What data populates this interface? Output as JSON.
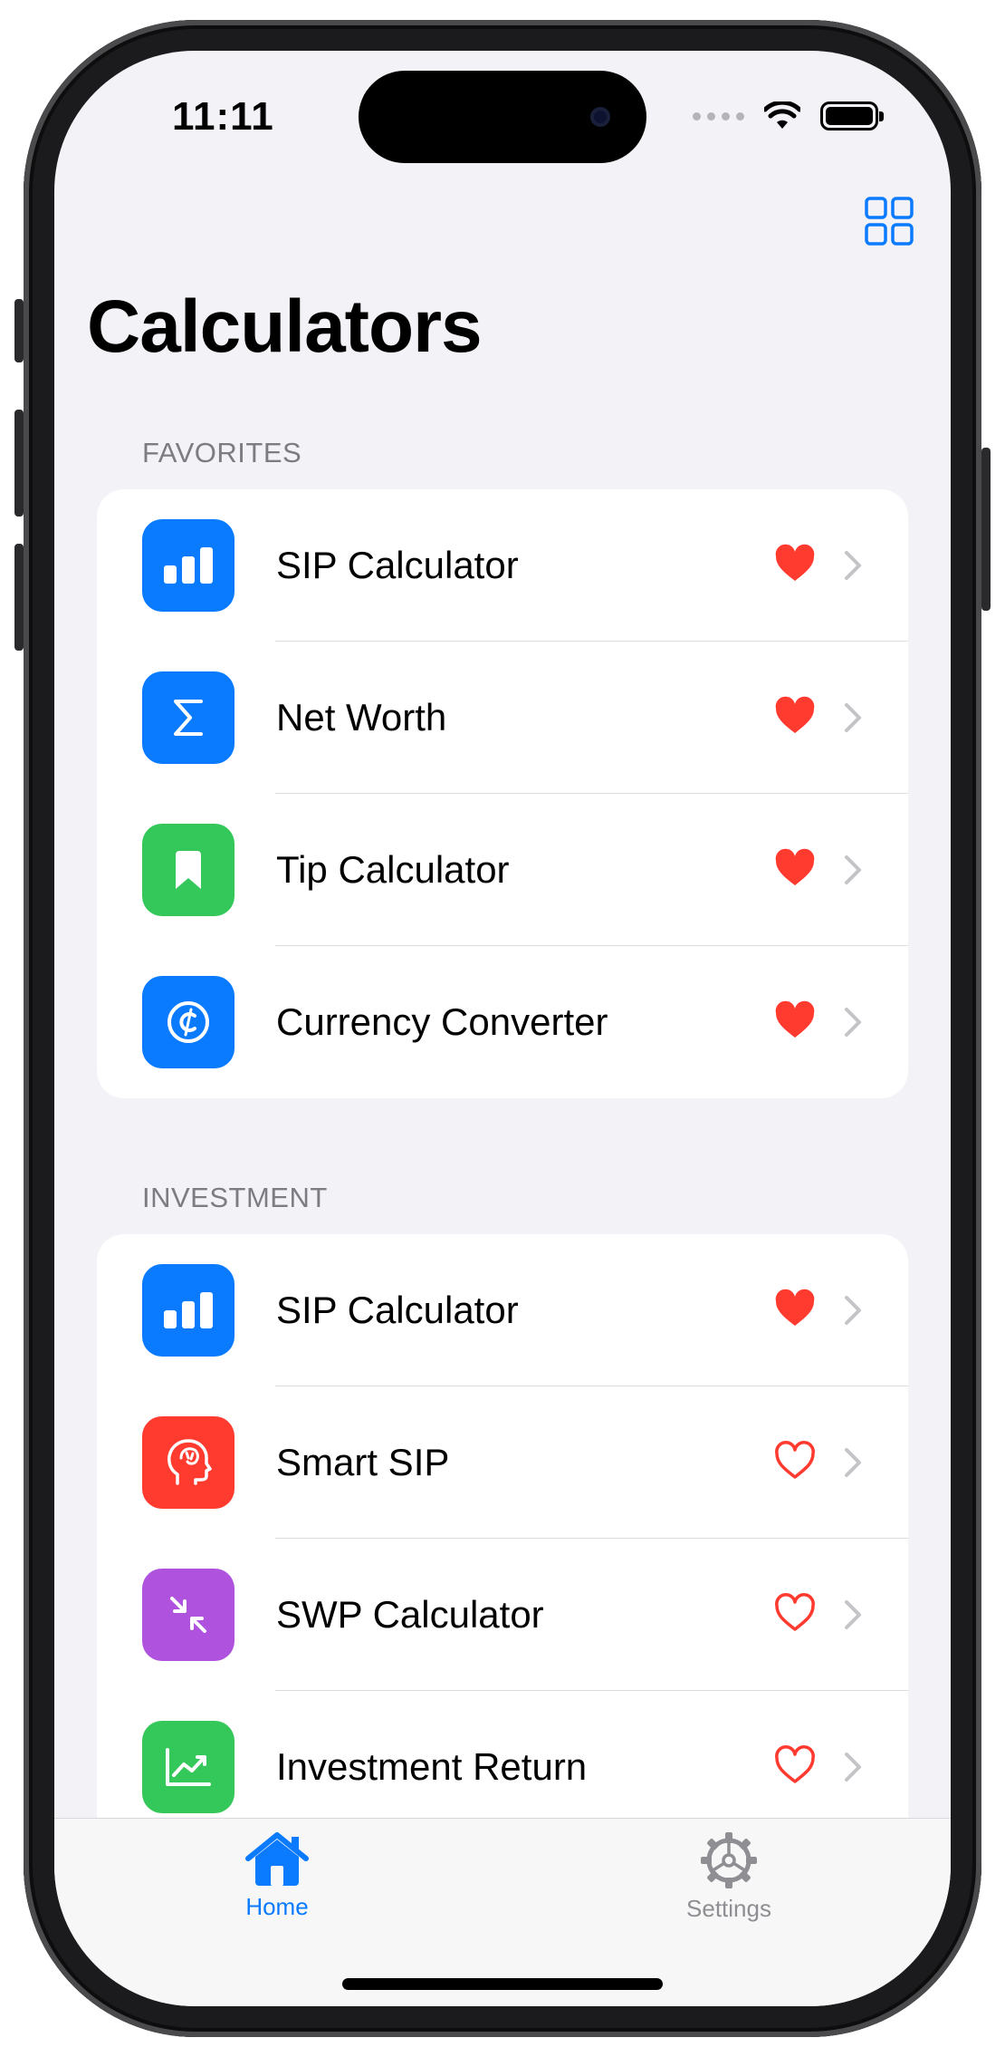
{
  "status_bar": {
    "time": "11:11"
  },
  "header": {
    "title": "Calculators",
    "grid_icon": "grid-icon"
  },
  "colors": {
    "accent": "#0a7aff",
    "heart": "#ff3b30",
    "green": "#34c759",
    "purple": "#af52de",
    "red": "#ff3b30"
  },
  "sections": [
    {
      "label": "FAVORITES",
      "items": [
        {
          "label": "SIP Calculator",
          "icon": "bar-chart-icon",
          "favorite": true
        },
        {
          "label": "Net Worth",
          "icon": "sigma-icon",
          "favorite": true
        },
        {
          "label": "Tip Calculator",
          "icon": "bookmark-icon",
          "favorite": true
        },
        {
          "label": "Currency Converter",
          "icon": "currency-icon",
          "favorite": true
        }
      ]
    },
    {
      "label": "INVESTMENT",
      "items": [
        {
          "label": "SIP Calculator",
          "icon": "bar-chart-icon",
          "favorite": true
        },
        {
          "label": "Smart SIP",
          "icon": "brain-head-icon",
          "favorite": false
        },
        {
          "label": "SWP Calculator",
          "icon": "arrows-in-icon",
          "favorite": false
        },
        {
          "label": "Investment Return",
          "icon": "trend-chart-icon",
          "favorite": false
        }
      ]
    }
  ],
  "tabbar": {
    "home_label": "Home",
    "settings_label": "Settings"
  }
}
